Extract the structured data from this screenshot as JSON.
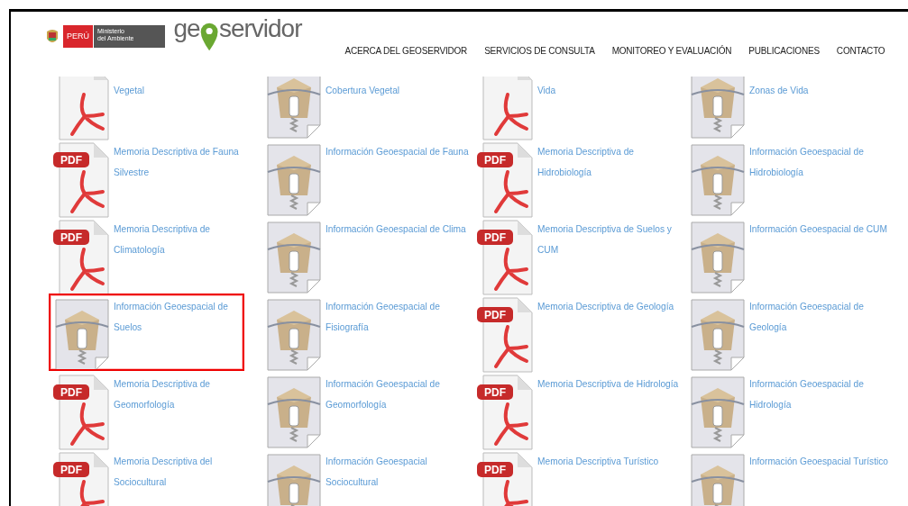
{
  "header": {
    "brand": {
      "country": "PERÚ",
      "ministry_line1": "Ministerio",
      "ministry_line2": "del Ambiente"
    },
    "logo": {
      "left": "ge",
      "right": "servidor"
    },
    "nav": [
      {
        "label": "ACERCA DEL GEOSERVIDOR"
      },
      {
        "label": "SERVICIOS DE CONSULTA"
      },
      {
        "label": "MONITOREO Y EVALUACIÓN"
      },
      {
        "label": "PUBLICACIONES"
      },
      {
        "label": "CONTACTO"
      }
    ]
  },
  "files": [
    {
      "kind": "pdf",
      "title": "Vegetal",
      "selected": false
    },
    {
      "kind": "zip",
      "title": "Cobertura Vegetal",
      "selected": false
    },
    {
      "kind": "pdf",
      "title": "Vida",
      "selected": false
    },
    {
      "kind": "zip",
      "title": "Zonas de Vida",
      "selected": false
    },
    {
      "kind": "pdf",
      "badge": "PDF",
      "title": "Memoria Descriptiva de Fauna Silvestre",
      "selected": false
    },
    {
      "kind": "zip",
      "title": "Información Geoespacial de Fauna",
      "selected": false
    },
    {
      "kind": "pdf",
      "badge": "PDF",
      "title": "Memoria Descriptiva de Hidrobiología",
      "selected": false
    },
    {
      "kind": "zip",
      "title": "Información Geoespacial de Hidrobiología",
      "selected": false
    },
    {
      "kind": "pdf",
      "badge": "PDF",
      "title": "Memoria Descriptiva de Climatología",
      "selected": false
    },
    {
      "kind": "zip",
      "title": "Información Geoespacial de Clima",
      "selected": false
    },
    {
      "kind": "pdf",
      "badge": "PDF",
      "title": "Memoria Descriptiva de Suelos y CUM",
      "selected": false
    },
    {
      "kind": "zip",
      "title": "Información Geoespacial de CUM",
      "selected": false
    },
    {
      "kind": "zip",
      "title": "Información Geoespacial de Suelos",
      "selected": true
    },
    {
      "kind": "zip",
      "title": "Información Geoespacial de Fisiografía",
      "selected": false
    },
    {
      "kind": "pdf",
      "badge": "PDF",
      "title": "Memoria Descriptiva de Geología",
      "selected": false
    },
    {
      "kind": "zip",
      "title": "Información Geoespacial de Geología",
      "selected": false
    },
    {
      "kind": "pdf",
      "badge": "PDF",
      "title": "Memoria Descriptiva de Geomorfología",
      "selected": false
    },
    {
      "kind": "zip",
      "title": "Información Geoespacial de Geomorfología",
      "selected": false
    },
    {
      "kind": "pdf",
      "badge": "PDF",
      "title": "Memoria Descriptiva de Hidrología",
      "selected": false
    },
    {
      "kind": "zip",
      "title": "Información Geoespacial de Hidrología",
      "selected": false
    },
    {
      "kind": "pdf",
      "badge": "PDF",
      "title": "Memoria Descriptiva del Sociocultural",
      "selected": false
    },
    {
      "kind": "zip",
      "title": "Información Geoespacial Sociocultural",
      "selected": false
    },
    {
      "kind": "pdf",
      "badge": "PDF",
      "title": "Memoria Descriptiva Turístico",
      "selected": false
    },
    {
      "kind": "zip",
      "title": "Información Geoespacial Turístico",
      "selected": false
    }
  ]
}
